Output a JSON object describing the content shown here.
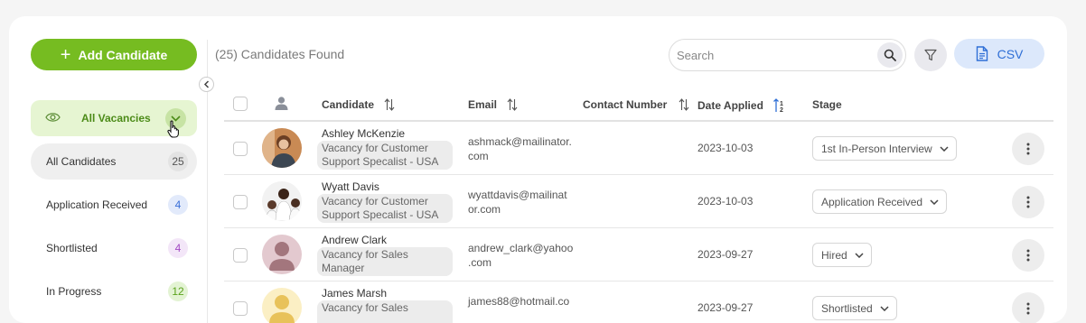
{
  "sidebar": {
    "add_button_label": "Add Candidate",
    "vacancy_filter_label": "All Vacancies",
    "items": [
      {
        "label": "All Candidates",
        "count": "25",
        "badge_bg": "#e3e3e3",
        "badge_color": "#555"
      },
      {
        "label": "Application Received",
        "count": "4",
        "badge_bg": "#e2eafb",
        "badge_color": "#3a6fd8"
      },
      {
        "label": "Shortlisted",
        "count": "4",
        "badge_bg": "#f3e6f8",
        "badge_color": "#a349c4"
      },
      {
        "label": "In Progress",
        "count": "12",
        "badge_bg": "#e3f3d3",
        "badge_color": "#5aa21c"
      }
    ]
  },
  "toolbar": {
    "results_text": "(25) Candidates Found",
    "search_placeholder": "Search",
    "csv_label": "CSV"
  },
  "table": {
    "columns": {
      "candidate": "Candidate",
      "email": "Email",
      "contact": "Contact Number",
      "date_applied": "Date Applied",
      "stage": "Stage"
    },
    "rows": [
      {
        "name": "Ashley McKenzie",
        "vacancy_line1": "Vacancy for Customer",
        "vacancy_line2": "Support Specalist - USA",
        "email_line1": "ashmack@mailinator.",
        "email_line2": "com",
        "contact": "",
        "date": "2023-10-03",
        "stage": "1st In-Person Interview"
      },
      {
        "name": "Wyatt Davis",
        "vacancy_line1": "Vacancy for Customer",
        "vacancy_line2": "Support Specalist - USA",
        "email_line1": "wyattdavis@mailinat",
        "email_line2": "or.com",
        "contact": "",
        "date": "2023-10-03",
        "stage": "Application Received"
      },
      {
        "name": "Andrew Clark",
        "vacancy_line1": "Vacancy for Sales",
        "vacancy_line2": "Manager",
        "email_line1": "andrew_clark@yahoo",
        "email_line2": ".com",
        "contact": "",
        "date": "2023-09-27",
        "stage": "Hired"
      },
      {
        "name": "James Marsh",
        "vacancy_line1": "Vacancy for Sales",
        "vacancy_line2": "",
        "email_line1": "james88@hotmail.co",
        "email_line2": "",
        "contact": "",
        "date": "2023-09-27",
        "stage": "Shortlisted"
      }
    ]
  },
  "colors": {
    "accent_green": "#76bc21",
    "csv_blue": "#2f6fd6"
  },
  "icons": [
    "plus-icon",
    "chevron-left-icon",
    "eye-icon",
    "chevron-down-icon",
    "hand-cursor-icon",
    "search-icon",
    "filter-icon",
    "document-icon",
    "user-icon",
    "sort-icon",
    "sort-numeric-asc-icon",
    "more-vertical-icon"
  ]
}
